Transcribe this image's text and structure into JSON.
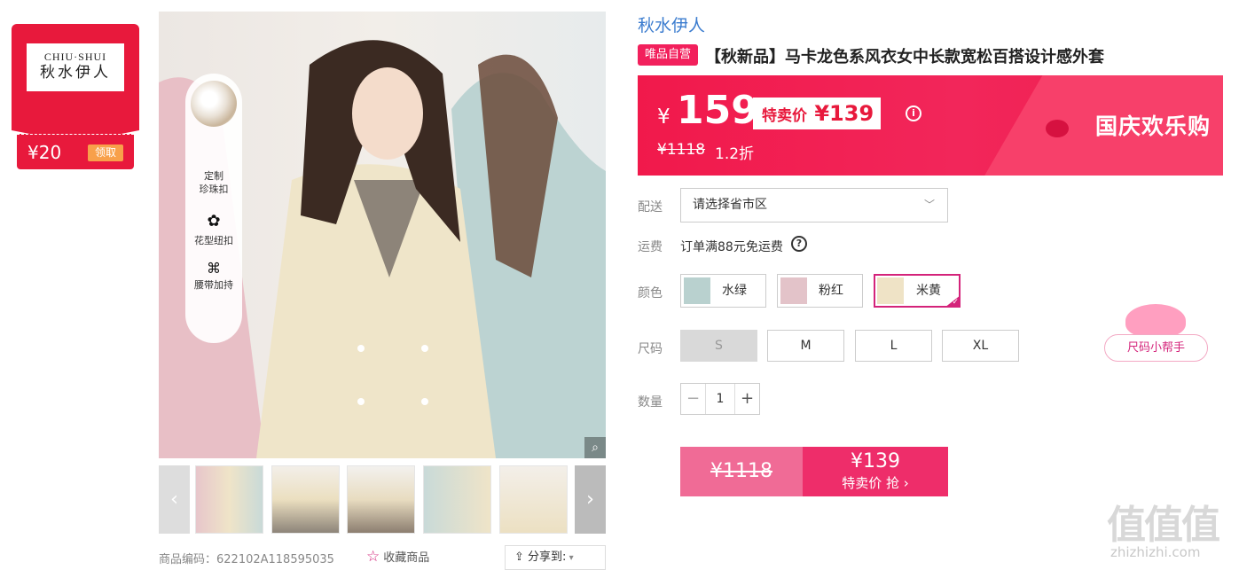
{
  "brand_card": {
    "logo_en": "CHIU·SHUI",
    "logo_cn": "秋水伊人",
    "coupon_amount": "¥20",
    "coupon_button": "领取"
  },
  "gallery": {
    "features": [
      {
        "label": "定制\n珍珠扣",
        "icon": "pearl-button-icon"
      },
      {
        "label": "花型纽扣",
        "icon": "flower-button-icon",
        "glyph": "✿"
      },
      {
        "label": "腰带加持",
        "icon": "bow-icon",
        "glyph": "🎀"
      }
    ],
    "thumb_prev": "‹",
    "thumb_next": "›",
    "thumb_count": 5
  },
  "footer_meta": {
    "sku_label": "商品编码：622102A118595035",
    "collect_label": "收藏商品",
    "share_label": "分享到:"
  },
  "product": {
    "brand": "秋水伊人",
    "vip_tag": "唯品自营",
    "title": "【秋新品】马卡龙色系风衣女中长款宽松百搭设计感外套"
  },
  "price": {
    "currency": "¥",
    "current": "159",
    "special_label": "特卖价",
    "special_price": "¥139",
    "original": "¥1118",
    "discount": "1.2折",
    "banner_text": "国庆欢乐购"
  },
  "delivery": {
    "label": "配送",
    "region_placeholder": "请选择省市区"
  },
  "shipping": {
    "label": "运费",
    "text": "订单满88元免运费"
  },
  "colors": {
    "label": "颜色",
    "options": [
      {
        "name": "水绿",
        "swatch": "#b9d1cf"
      },
      {
        "name": "粉红",
        "swatch": "#e3c3c9"
      },
      {
        "name": "米黄",
        "swatch": "#efe3c6",
        "selected": true
      }
    ]
  },
  "sizes": {
    "label": "尺码",
    "options": [
      "S",
      "M",
      "L",
      "XL"
    ],
    "disabled": [
      "S"
    ],
    "helper": "尺码小帮手"
  },
  "quantity": {
    "label": "数量",
    "value": "1"
  },
  "buy": {
    "original": "¥1118",
    "price": "¥139",
    "action": "特卖价 抢 ›"
  },
  "watermark": {
    "logo": "值值值",
    "url": "zhizhizhi.com"
  },
  "colors_theme": {
    "accent": "#e8193c",
    "pink": "#d4237a",
    "link": "#3b7ccf"
  }
}
